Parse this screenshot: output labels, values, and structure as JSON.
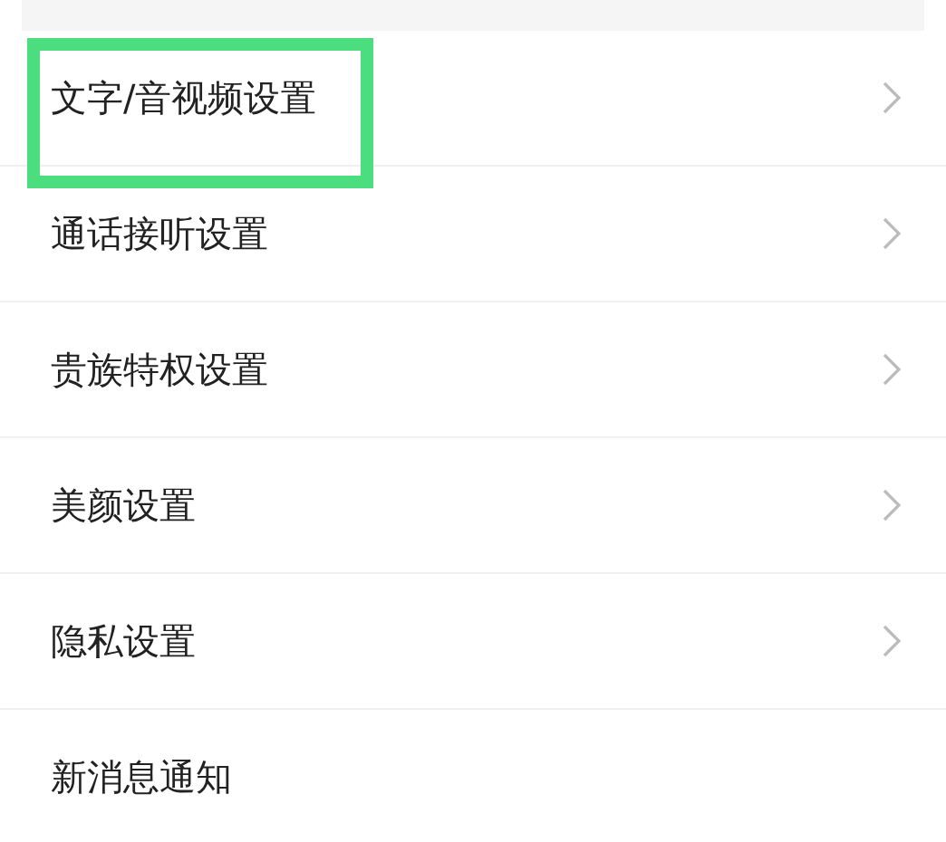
{
  "items": [
    {
      "label": "文字/音视频设置",
      "chevron": true,
      "highlighted": true
    },
    {
      "label": "通话接听设置",
      "chevron": true,
      "highlighted": false
    },
    {
      "label": "贵族特权设置",
      "chevron": true,
      "highlighted": false
    },
    {
      "label": "美颜设置",
      "chevron": true,
      "highlighted": false
    },
    {
      "label": "隐私设置",
      "chevron": true,
      "highlighted": false
    },
    {
      "label": "新消息通知",
      "chevron": false,
      "highlighted": false
    }
  ]
}
